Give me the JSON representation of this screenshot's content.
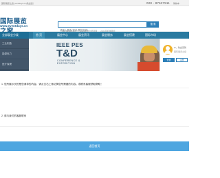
{
  "topbar": {
    "welcome": "国际展览之窗 (ventdays.cn)欢迎您！",
    "phone": "028 - 87627511",
    "cart": "购物车"
  },
  "logo": {
    "name_cn": "国际展览之窗",
    "url": "www.eventdays.cn"
  },
  "search": {
    "tabs": [
      "展会",
      "资讯"
    ],
    "placeholder": "请输入展会/资讯/展馆名称",
    "button": "搜 索",
    "hot": [
      "2024年国际展会",
      "2024年电力能源展",
      "2024年机械展会"
    ]
  },
  "nav": {
    "all_label": "全部展会分类",
    "items": [
      "首 页",
      "展会中心",
      "展会资讯",
      "展会服务",
      "展会搭建",
      "国际市场"
    ]
  },
  "sidebar": {
    "items": [
      "工业制造",
      "能源电力",
      "医疗保健"
    ]
  },
  "banner": {
    "org": "IEEE PES",
    "title": "T&D",
    "line1": "CONFERENCE &",
    "line2": "EXPOSITION"
  },
  "login": {
    "greet": "Hi，欢迎来到",
    "greet2": "国际展览之窗",
    "login_label": "登录",
    "register_label": "注册"
  },
  "modal": {
    "message": "1. 您所展示页的是您请求的内容，请点击右上角切换您所需要的内容，或联系客服获取帮助！",
    "message2": "2. 请与我们的客服联系",
    "return_button": "返回首页"
  },
  "colors": {
    "brand_blue": "#2d7fb8",
    "nav_bg": "#2a7aa0",
    "sidebar_bg": "#43566a",
    "button_blue": "#4ea6e0"
  }
}
